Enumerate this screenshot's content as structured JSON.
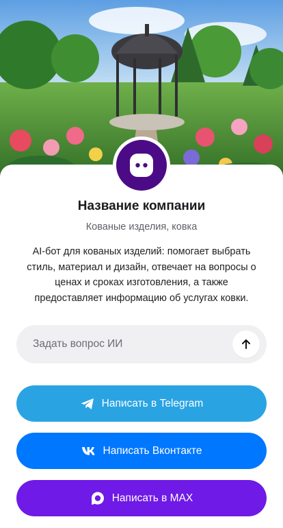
{
  "hero": {
    "image": "garden-gazebo-image"
  },
  "company": {
    "avatar_icon": "chat-bot-icon",
    "avatar_color": "#4c0b86",
    "name": "Название компании",
    "subtitle": "Кованые изделия, ковка",
    "description": "AI-бот для кованых изделий: помогает выбрать стиль, материал и дизайн, отвечает на вопросы о ценах и сроках изготовления, а также предоставляет информацию об услугах ковки."
  },
  "ask": {
    "placeholder": "Задать вопрос ИИ",
    "send_icon": "arrow-up-icon"
  },
  "buttons": {
    "telegram": {
      "label": "Написать в Telegram",
      "icon": "telegram-icon",
      "color": "#2aa3e3"
    },
    "vk": {
      "label": "Написать Вконтакте",
      "icon": "vk-icon",
      "color": "#0077ff"
    },
    "max": {
      "label": "Написать в MAX",
      "icon": "max-icon",
      "color": "#6f1ae6"
    }
  }
}
